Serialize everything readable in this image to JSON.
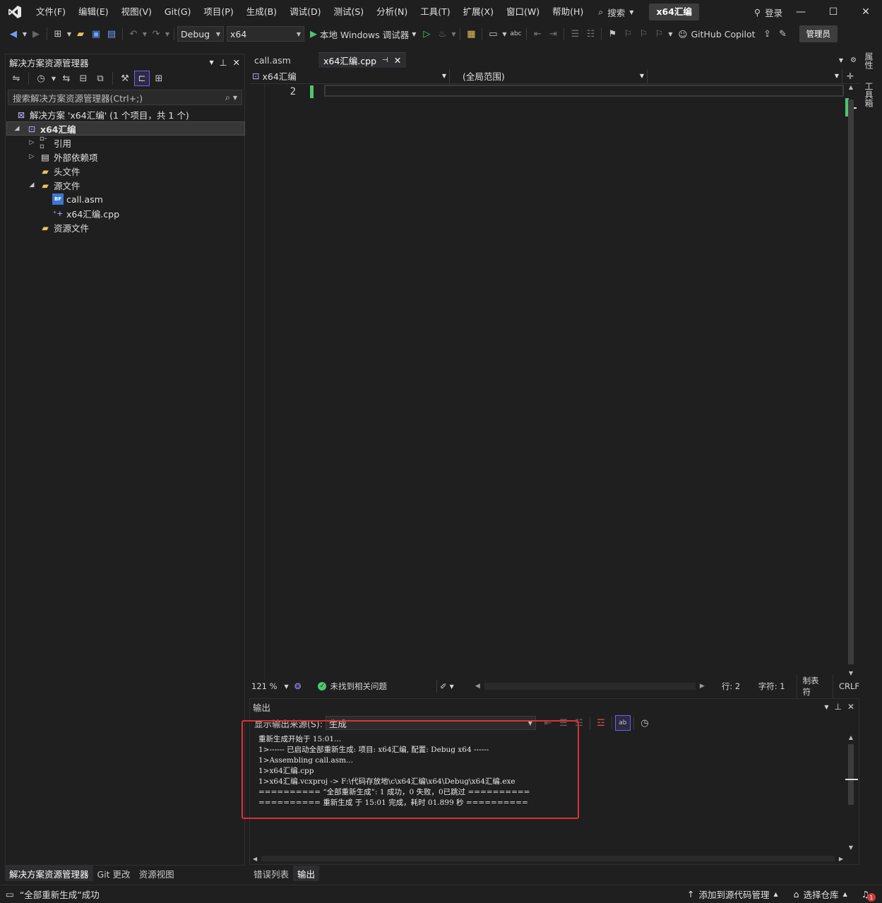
{
  "menu": {
    "items": [
      "文件(F)",
      "编辑(E)",
      "视图(V)",
      "Git(G)",
      "项目(P)",
      "生成(B)",
      "调试(D)",
      "测试(S)",
      "分析(N)",
      "工具(T)",
      "扩展(X)",
      "窗口(W)",
      "帮助(H)"
    ],
    "search_label": "搜索",
    "project_name": "x64汇编",
    "login_label": "登录"
  },
  "toolbar": {
    "config": "Debug",
    "platform": "x64",
    "run_label": "本地 Windows 调试器",
    "copilot_label": "GitHub Copilot",
    "admin_label": "管理员"
  },
  "solution_explorer": {
    "title": "解决方案资源管理器",
    "search_placeholder": "搜索解决方案资源管理器(Ctrl+;)",
    "solution_label": "解决方案 'x64汇编' (1 个项目，共 1 个)",
    "project_label": "x64汇编",
    "tree": {
      "references": "引用",
      "external": "外部依赖项",
      "headers": "头文件",
      "sources": "源文件",
      "file_asm": "call.asm",
      "file_cpp": "x64汇编.cpp",
      "resources": "资源文件"
    },
    "bottom_tabs": [
      "解决方案资源管理器",
      "Git 更改",
      "资源视图"
    ]
  },
  "editor": {
    "tabs": [
      {
        "label": "call.asm"
      },
      {
        "label": "x64汇编.cpp"
      }
    ],
    "nav_project": "x64汇编",
    "nav_scope": "(全局范围)",
    "line_number": "2",
    "zoom": "121 %",
    "issues": "未找到相关问题",
    "line": "行: 2",
    "char": "字符: 1",
    "tab_mode": "制表符",
    "eol": "CRLF"
  },
  "right_rail": {
    "properties": "属性",
    "toolbox": "工具箱"
  },
  "output": {
    "title": "输出",
    "source_label": "显示输出来源(S):",
    "source_value": "生成",
    "lines": [
      "重新生成开始于 15:01...",
      "1>------ 已启动全部重新生成: 项目: x64汇编, 配置: Debug x64 ------",
      "1>Assembling call.asm...",
      "1>x64汇编.cpp",
      "1>x64汇编.vcxproj -> F:\\代码存放地\\c\\x64汇编\\x64\\Debug\\x64汇编.exe",
      "========== “全部重新生成”: 1 成功，0 失败，0已跳过 ==========",
      "========== 重新生成 于 15:01 完成，耗时 01.899 秒 =========="
    ],
    "bottom_tabs": [
      "错误列表",
      "输出"
    ]
  },
  "statusbar": {
    "message": "“全部重新生成”成功",
    "source_control": "添加到源代码管理",
    "repo": "选择仓库",
    "notification_count": "1"
  },
  "colors": {
    "accent": "#7160e8",
    "success": "#4ec66e",
    "highlight_box": "#e03030"
  }
}
